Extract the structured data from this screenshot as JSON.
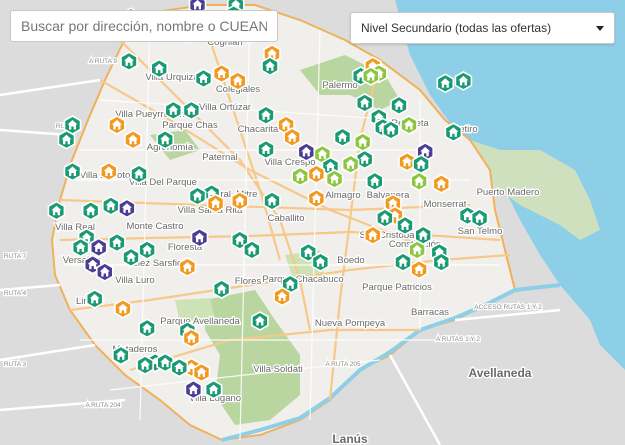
{
  "search": {
    "placeholder": "Buscar por dirección, nombre o CUEANEXO",
    "value": ""
  },
  "filter": {
    "selected": "Nivel Secundario (todas las ofertas)"
  },
  "colors": {
    "estatal": "#1a9a73",
    "privada": "#f29a1f",
    "tecnica": "#8cc63f",
    "otra": "#4b3c96",
    "water": "#8ecfe8",
    "park": "#b9d6a0",
    "city": "#f1efeb",
    "outside": "#dcdcdc"
  },
  "icons": {
    "marker": "school-marker-icon",
    "select": "chevron-down-icon"
  },
  "map": {
    "neighborhood_labels": [
      "Coghlan",
      "Villa Urquiza",
      "Colegiales",
      "Palermo",
      "Villa Ortúzar",
      "Villa Pueyrredón",
      "Parque Chas",
      "Chacarita",
      "Recoleta",
      "Retiro",
      "Agronomía",
      "Paternal",
      "Villa Crespo",
      "Puerto Madero",
      "Villa Devoto",
      "Villa Del Parque",
      "Villa Gral. Mitre",
      "Villa Santa Rita",
      "Almagro",
      "Balvanera",
      "Monserrat",
      "Caballito",
      "San Cristóbal",
      "San Telmo",
      "Villa Real",
      "Monte Castro",
      "Floresta",
      "Constitución",
      "Versalles",
      "Vélez Sarsfield",
      "Boedo",
      "Villa Luro",
      "Flores",
      "Parque Chacabuco",
      "Parque Patricios",
      "Liniers",
      "Parque Avellaneda",
      "Barracas",
      "Nueva Pompeya",
      "Mataderos",
      "Avellaneda",
      "Villa Soldati",
      "Villa Lugano",
      "Lanús"
    ],
    "road_labels": [
      "A RUTA 9",
      "RUTA 8",
      "RUTA 7",
      "RUTA 4",
      "RUTA 3",
      "A RUTA 204",
      "A RUTA 205",
      "A RUTAS 1 Y 2",
      "ACCESO RUTAS 1 Y 2"
    ],
    "markers": [
      {
        "lat": -34.561,
        "lon": -58.476,
        "type": "otra"
      },
      {
        "lat": -34.561,
        "lon": -58.457,
        "type": "estatal"
      },
      {
        "lat": -34.566,
        "lon": -58.509,
        "type": "estatal"
      },
      {
        "lat": -34.565,
        "lon": -58.458,
        "type": "estatal"
      },
      {
        "lat": -34.57,
        "lon": -58.455,
        "type": "estatal"
      },
      {
        "lat": -34.573,
        "lon": -58.481,
        "type": "estatal"
      },
      {
        "lat": -34.573,
        "lon": -58.45,
        "type": "estatal"
      },
      {
        "lat": -34.581,
        "lon": -58.439,
        "type": "privada"
      },
      {
        "lat": -34.584,
        "lon": -58.51,
        "type": "estatal"
      },
      {
        "lat": -34.586,
        "lon": -58.44,
        "type": "estatal"
      },
      {
        "lat": -34.586,
        "lon": -58.389,
        "type": "privada"
      },
      {
        "lat": -34.587,
        "lon": -58.495,
        "type": "estatal"
      },
      {
        "lat": -34.589,
        "lon": -58.464,
        "type": "privada"
      },
      {
        "lat": -34.589,
        "lon": -58.386,
        "type": "tecnica"
      },
      {
        "lat": -34.59,
        "lon": -58.395,
        "type": "estatal"
      },
      {
        "lat": -34.59,
        "lon": -58.39,
        "type": "tecnica"
      },
      {
        "lat": -34.591,
        "lon": -58.473,
        "type": "estatal"
      },
      {
        "lat": -34.592,
        "lon": -58.456,
        "type": "privada"
      },
      {
        "lat": -34.593,
        "lon": -58.353,
        "type": "estatal"
      },
      {
        "lat": -34.592,
        "lon": -58.344,
        "type": "estatal"
      },
      {
        "lat": -34.601,
        "lon": -58.393,
        "type": "estatal"
      },
      {
        "lat": -34.602,
        "lon": -58.376,
        "type": "estatal"
      },
      {
        "lat": -34.604,
        "lon": -58.488,
        "type": "estatal"
      },
      {
        "lat": -34.604,
        "lon": -58.479,
        "type": "estatal"
      },
      {
        "lat": -34.606,
        "lon": -58.442,
        "type": "estatal"
      },
      {
        "lat": -34.607,
        "lon": -58.386,
        "type": "estatal"
      },
      {
        "lat": -34.61,
        "lon": -58.538,
        "type": "estatal"
      },
      {
        "lat": -34.61,
        "lon": -58.516,
        "type": "privada"
      },
      {
        "lat": -34.61,
        "lon": -58.432,
        "type": "privada"
      },
      {
        "lat": -34.61,
        "lon": -58.371,
        "type": "tecnica"
      },
      {
        "lat": -34.611,
        "lon": -58.384,
        "type": "estatal"
      },
      {
        "lat": -34.612,
        "lon": -58.38,
        "type": "estatal"
      },
      {
        "lat": -34.613,
        "lon": -58.349,
        "type": "estatal"
      },
      {
        "lat": -34.616,
        "lon": -58.541,
        "type": "estatal"
      },
      {
        "lat": -34.616,
        "lon": -58.508,
        "type": "privada"
      },
      {
        "lat": -34.616,
        "lon": -58.492,
        "type": "estatal"
      },
      {
        "lat": -34.615,
        "lon": -58.429,
        "type": "privada"
      },
      {
        "lat": -34.615,
        "lon": -58.404,
        "type": "estatal"
      },
      {
        "lat": -34.617,
        "lon": -58.394,
        "type": "tecnica"
      },
      {
        "lat": -34.621,
        "lon": -58.363,
        "type": "otra"
      },
      {
        "lat": -34.62,
        "lon": -58.442,
        "type": "estatal"
      },
      {
        "lat": -34.621,
        "lon": -58.422,
        "type": "otra"
      },
      {
        "lat": -34.622,
        "lon": -58.414,
        "type": "tecnica"
      },
      {
        "lat": -34.624,
        "lon": -58.393,
        "type": "estatal"
      },
      {
        "lat": -34.625,
        "lon": -58.372,
        "type": "privada"
      },
      {
        "lat": -34.626,
        "lon": -58.4,
        "type": "tecnica"
      },
      {
        "lat": -34.627,
        "lon": -58.41,
        "type": "estatal"
      },
      {
        "lat": -34.626,
        "lon": -58.365,
        "type": "estatal"
      },
      {
        "lat": -34.629,
        "lon": -58.52,
        "type": "privada"
      },
      {
        "lat": -34.629,
        "lon": -58.538,
        "type": "estatal"
      },
      {
        "lat": -34.63,
        "lon": -58.505,
        "type": "estatal"
      },
      {
        "lat": -34.631,
        "lon": -58.425,
        "type": "tecnica"
      },
      {
        "lat": -34.63,
        "lon": -58.417,
        "type": "privada"
      },
      {
        "lat": -34.632,
        "lon": -58.408,
        "type": "tecnica"
      },
      {
        "lat": -34.633,
        "lon": -58.388,
        "type": "estatal"
      },
      {
        "lat": -34.633,
        "lon": -58.366,
        "type": "tecnica"
      },
      {
        "lat": -34.634,
        "lon": -58.355,
        "type": "privada"
      },
      {
        "lat": -34.638,
        "lon": -58.469,
        "type": "estatal"
      },
      {
        "lat": -34.639,
        "lon": -58.476,
        "type": "estatal"
      },
      {
        "lat": -34.64,
        "lon": -58.417,
        "type": "privada"
      },
      {
        "lat": -34.641,
        "lon": -58.439,
        "type": "estatal"
      },
      {
        "lat": -34.641,
        "lon": -58.455,
        "type": "privada"
      },
      {
        "lat": -34.642,
        "lon": -58.467,
        "type": "privada"
      },
      {
        "lat": -34.642,
        "lon": -58.379,
        "type": "privada"
      },
      {
        "lat": -34.643,
        "lon": -58.519,
        "type": "estatal"
      },
      {
        "lat": -34.644,
        "lon": -58.511,
        "type": "otra"
      },
      {
        "lat": -34.645,
        "lon": -58.546,
        "type": "estatal"
      },
      {
        "lat": -34.645,
        "lon": -58.529,
        "type": "estatal"
      },
      {
        "lat": -34.647,
        "lon": -58.342,
        "type": "estatal"
      },
      {
        "lat": -34.647,
        "lon": -58.378,
        "type": "privada"
      },
      {
        "lat": -34.648,
        "lon": -58.383,
        "type": "estatal"
      },
      {
        "lat": -34.648,
        "lon": -58.336,
        "type": "estatal"
      },
      {
        "lat": -34.651,
        "lon": -58.373,
        "type": "estatal"
      },
      {
        "lat": -34.655,
        "lon": -58.389,
        "type": "privada"
      },
      {
        "lat": -34.655,
        "lon": -58.364,
        "type": "estatal"
      },
      {
        "lat": -34.656,
        "lon": -58.531,
        "type": "estatal"
      },
      {
        "lat": -34.656,
        "lon": -58.475,
        "type": "otra"
      },
      {
        "lat": -34.657,
        "lon": -58.455,
        "type": "estatal"
      },
      {
        "lat": -34.658,
        "lon": -58.516,
        "type": "estatal"
      },
      {
        "lat": -34.66,
        "lon": -58.534,
        "type": "estatal"
      },
      {
        "lat": -34.66,
        "lon": -58.525,
        "type": "otra"
      },
      {
        "lat": -34.661,
        "lon": -58.501,
        "type": "estatal"
      },
      {
        "lat": -34.661,
        "lon": -58.449,
        "type": "estatal"
      },
      {
        "lat": -34.661,
        "lon": -58.367,
        "type": "tecnica"
      },
      {
        "lat": -34.662,
        "lon": -58.421,
        "type": "estatal"
      },
      {
        "lat": -34.662,
        "lon": -58.356,
        "type": "estatal"
      },
      {
        "lat": -34.664,
        "lon": -58.509,
        "type": "estatal"
      },
      {
        "lat": -34.666,
        "lon": -58.415,
        "type": "estatal"
      },
      {
        "lat": -34.666,
        "lon": -58.374,
        "type": "estatal"
      },
      {
        "lat": -34.666,
        "lon": -58.355,
        "type": "estatal"
      },
      {
        "lat": -34.667,
        "lon": -58.528,
        "type": "otra"
      },
      {
        "lat": -34.668,
        "lon": -58.481,
        "type": "privada"
      },
      {
        "lat": -34.669,
        "lon": -58.366,
        "type": "privada"
      },
      {
        "lat": -34.67,
        "lon": -58.522,
        "type": "otra"
      },
      {
        "lat": -34.675,
        "lon": -58.43,
        "type": "estatal"
      },
      {
        "lat": -34.677,
        "lon": -58.464,
        "type": "estatal"
      },
      {
        "lat": -34.68,
        "lon": -58.434,
        "type": "privada"
      },
      {
        "lat": -34.681,
        "lon": -58.527,
        "type": "estatal"
      },
      {
        "lat": -34.685,
        "lon": -58.513,
        "type": "privada"
      },
      {
        "lat": -34.69,
        "lon": -58.445,
        "type": "estatal"
      },
      {
        "lat": -34.693,
        "lon": -58.501,
        "type": "estatal"
      },
      {
        "lat": -34.694,
        "lon": -58.481,
        "type": "estatal"
      },
      {
        "lat": -34.697,
        "lon": -58.479,
        "type": "privada"
      },
      {
        "lat": -34.704,
        "lon": -58.514,
        "type": "estatal"
      },
      {
        "lat": -34.707,
        "lon": -58.497,
        "type": "estatal"
      },
      {
        "lat": -34.707,
        "lon": -58.492,
        "type": "estatal"
      },
      {
        "lat": -34.708,
        "lon": -58.502,
        "type": "estatal"
      },
      {
        "lat": -34.709,
        "lon": -58.479,
        "type": "privada"
      },
      {
        "lat": -34.709,
        "lon": -58.485,
        "type": "estatal"
      },
      {
        "lat": -34.711,
        "lon": -58.474,
        "type": "privada"
      },
      {
        "lat": -34.718,
        "lon": -58.478,
        "type": "otra"
      },
      {
        "lat": -34.718,
        "lon": -58.468,
        "type": "estatal"
      }
    ]
  }
}
